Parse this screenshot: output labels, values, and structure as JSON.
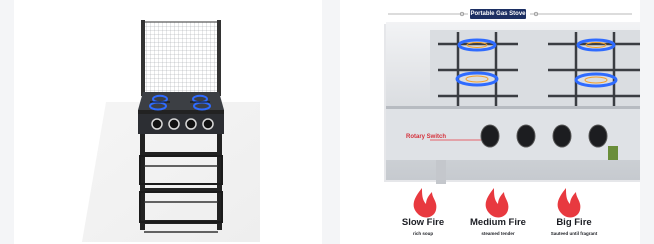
{
  "banner": {
    "tag": "Portable Gas Stove",
    "callout": "Rotary Switch",
    "fire_levels": [
      {
        "title": "Slow Fire",
        "subtitle": "rich soup",
        "icon": "flame-icon"
      },
      {
        "title": "Medium Fire",
        "subtitle": "steamed tender",
        "icon": "flame-icon"
      },
      {
        "title": "Big Fire",
        "subtitle": "Sauteed until fragrant",
        "icon": "flame-icon"
      }
    ]
  },
  "colors": {
    "accent_red": "#e8393f",
    "navy_tag": "#1c2f63",
    "flame_blue": "#2f6bff",
    "background": "#f4f5f7"
  }
}
